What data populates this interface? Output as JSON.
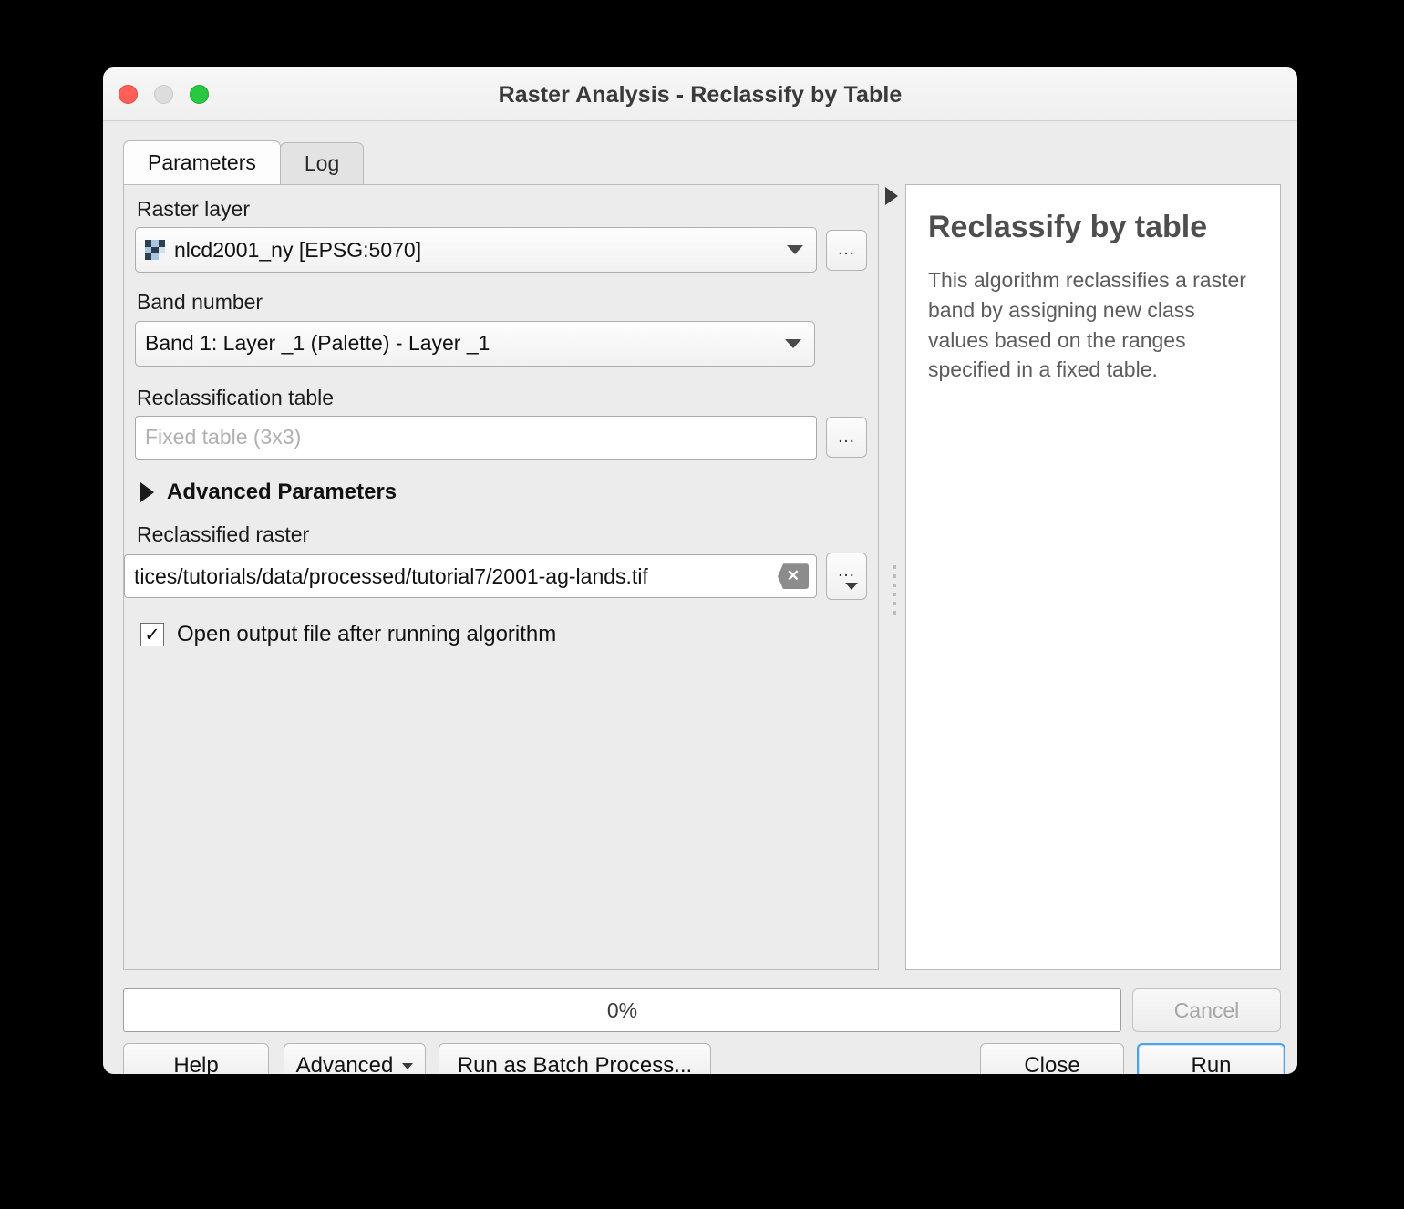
{
  "window": {
    "title": "Raster Analysis - Reclassify by Table",
    "traffic_lights": [
      "close-red",
      "minimize-grey",
      "zoom-green"
    ],
    "accent_color": "#4da3e8"
  },
  "tabs": [
    {
      "label": "Parameters",
      "active": true
    },
    {
      "label": "Log",
      "active": false
    }
  ],
  "parameters": {
    "raster_layer": {
      "label": "Raster layer",
      "value": "nlcd2001_ny [EPSG:5070]",
      "icon": "raster-layer-icon",
      "browse_label": "..."
    },
    "band_number": {
      "label": "Band number",
      "value": "Band 1: Layer _1 (Palette) - Layer _1"
    },
    "reclassification_table": {
      "label": "Reclassification table",
      "placeholder": "Fixed table (3x3)",
      "value": "",
      "browse_label": "..."
    },
    "advanced_parameters": {
      "label": "Advanced Parameters",
      "expanded": false
    },
    "reclassified_raster": {
      "label": "Reclassified raster",
      "value": "tices/tutorials/data/processed/tutorial7/2001-ag-lands.tif",
      "clear_label": "✕",
      "browse_label": "..."
    },
    "open_output": {
      "label": "Open output file after running algorithm",
      "checked": true,
      "check_glyph": "✓"
    }
  },
  "help": {
    "title": "Reclassify by table",
    "body": "This algorithm reclassifies a raster band by assigning new class values based on the ranges specified in a fixed table."
  },
  "footer": {
    "progress_text": "0%",
    "progress_percent": 0,
    "cancel_label": "Cancel",
    "help_label": "Help",
    "advanced_label": "Advanced",
    "batch_label": "Run as Batch Process...",
    "close_label": "Close",
    "run_label": "Run"
  }
}
